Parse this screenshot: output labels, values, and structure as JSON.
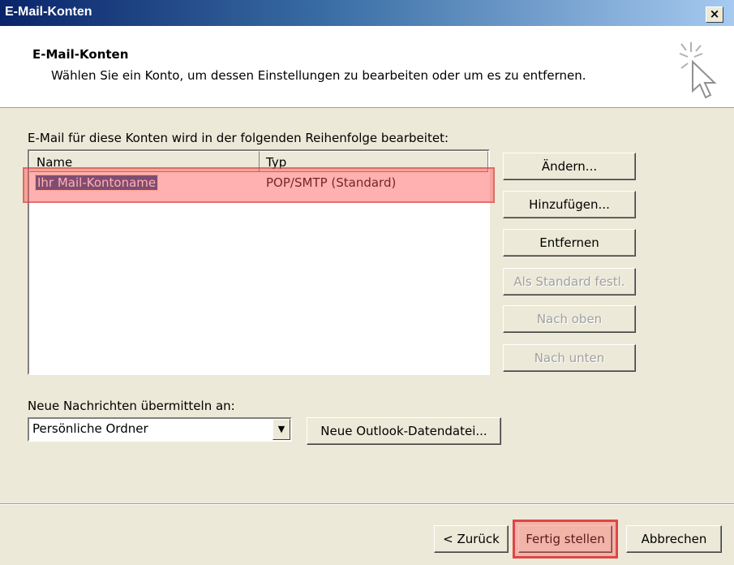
{
  "window": {
    "title": "E-Mail-Konten",
    "close_label": "×"
  },
  "header": {
    "title": "E-Mail-Konten",
    "subtitle": "Wählen Sie ein Konto, um dessen Einstellungen zu bearbeiten oder um es zu entfernen.",
    "icon": "wand-cursor-icon"
  },
  "accounts": {
    "caption": "E-Mail für diese Konten wird in der folgenden Reihenfolge bearbeitet:",
    "columns": [
      "Name",
      "Typ"
    ],
    "rows": [
      {
        "name": "Ihr Mail-Kontoname",
        "type": "POP/SMTP (Standard)",
        "selected": true
      }
    ],
    "highlight_color": "#ff5050"
  },
  "side_buttons": {
    "change": "Ändern...",
    "add": "Hinzufügen...",
    "remove": "Entfernen",
    "set_default": "Als Standard festl.",
    "move_up": "Nach oben",
    "move_down": "Nach unten"
  },
  "delivery": {
    "label": "Neue Nachrichten übermitteln an:",
    "selected": "Persönliche Ordner",
    "new_datafile": "Neue Outlook-Datendatei..."
  },
  "footer": {
    "back": "< Zurück",
    "finish": "Fertig stellen",
    "cancel": "Abbrechen"
  }
}
